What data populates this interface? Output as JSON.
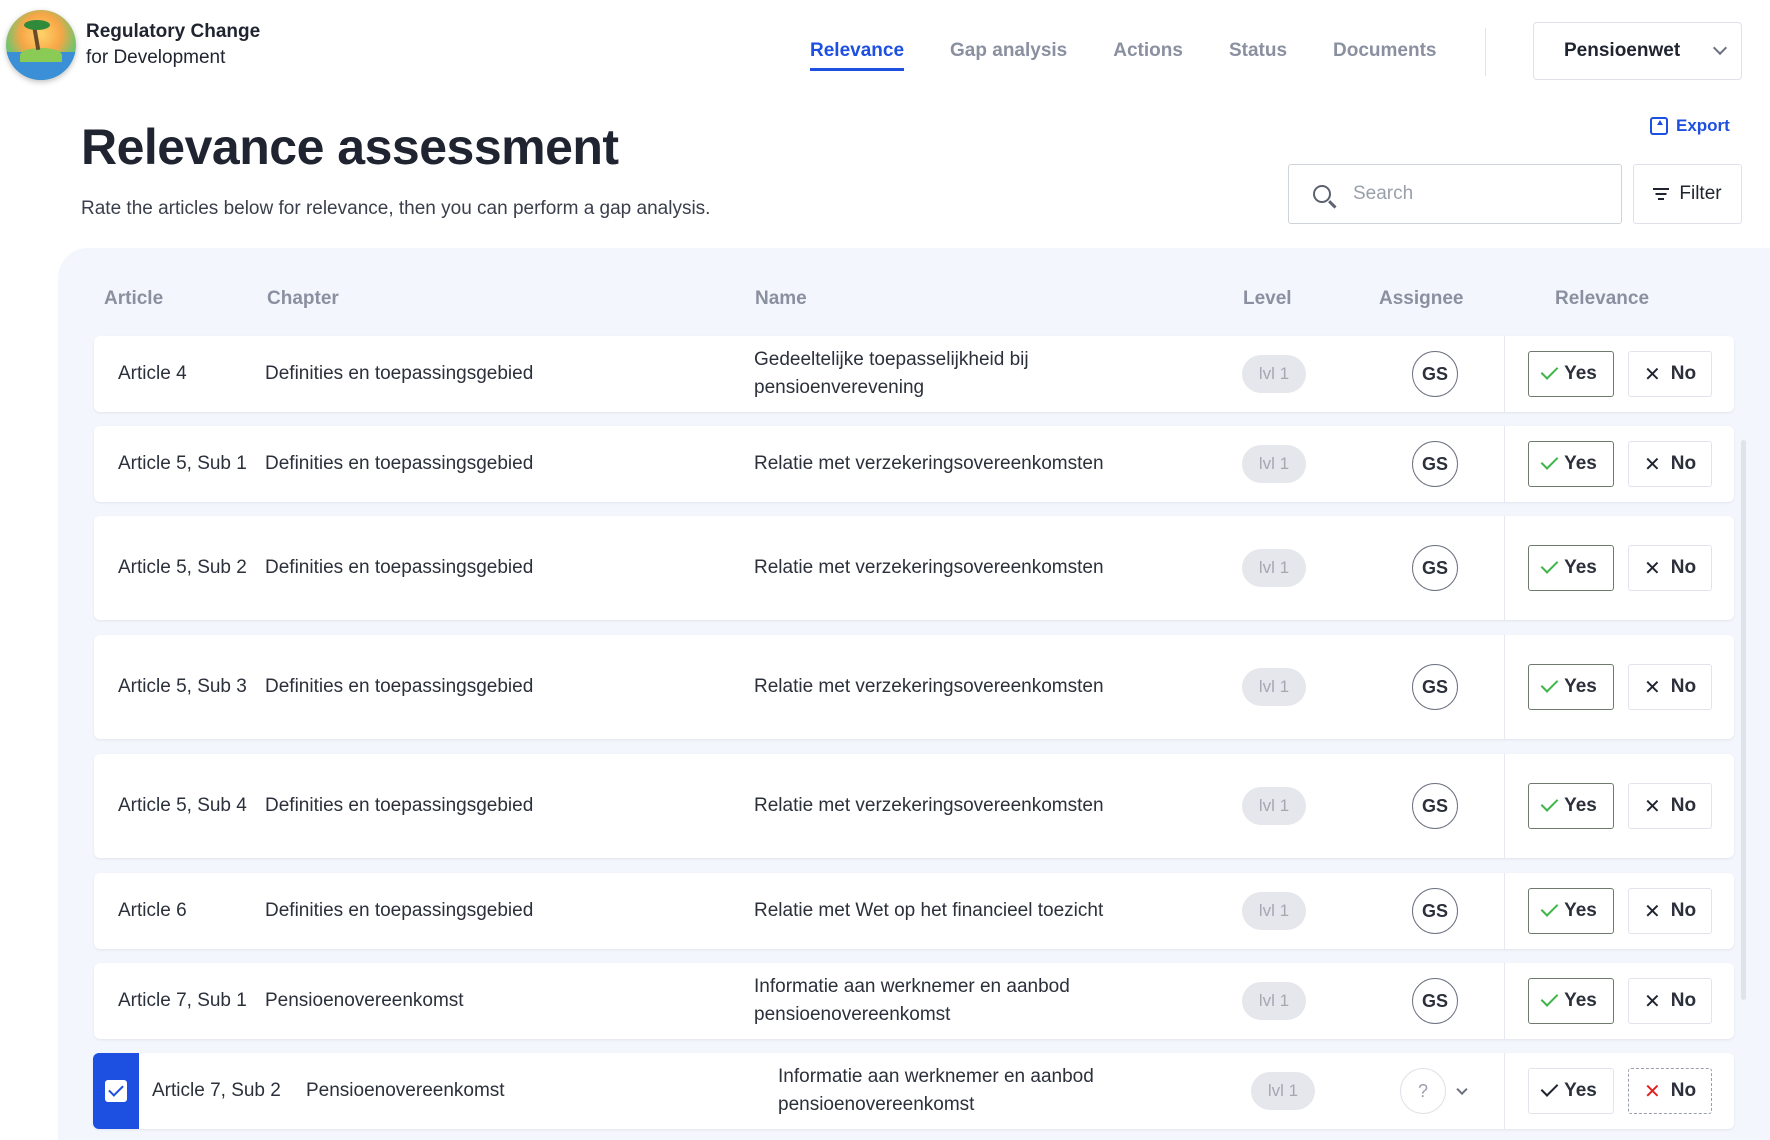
{
  "brand": {
    "title": "Regulatory Change",
    "subtitle": "for Development"
  },
  "nav": {
    "tabs": [
      {
        "label": "Relevance",
        "active": true
      },
      {
        "label": "Gap analysis",
        "active": false
      },
      {
        "label": "Actions",
        "active": false
      },
      {
        "label": "Status",
        "active": false
      },
      {
        "label": "Documents",
        "active": false
      }
    ],
    "law_select": {
      "value": "Pensioenwet"
    }
  },
  "page": {
    "title": "Relevance assessment",
    "subtitle": "Rate the articles below for relevance, then you can perform a gap analysis.",
    "export_label": "Export",
    "search_placeholder": "Search",
    "filter_label": "Filter"
  },
  "table": {
    "columns": [
      "Article",
      "Chapter",
      "Name",
      "Level",
      "Assignee",
      "Relevance"
    ],
    "yes_label": "Yes",
    "no_label": "No",
    "rows": [
      {
        "article": "Article 4",
        "chapter": "Definities en toepassingsgebied",
        "name": "Gedeeltelijke toepasselijkheid bij pensioenverevening",
        "level": "lvl 1",
        "assignee": "GS"
      },
      {
        "article": "Article 5, Sub 1",
        "chapter": "Definities en toepassingsgebied",
        "name": "Relatie met verzekeringsovereenkomsten",
        "level": "lvl 1",
        "assignee": "GS"
      },
      {
        "article": "Article 5, Sub 2",
        "chapter": "Definities en toepassingsgebied",
        "name": "Relatie met verzekeringsovereenkomsten",
        "level": "lvl 1",
        "assignee": "GS"
      },
      {
        "article": "Article 5, Sub 3",
        "chapter": "Definities en toepassingsgebied",
        "name": "Relatie met verzekeringsovereenkomsten",
        "level": "lvl 1",
        "assignee": "GS"
      },
      {
        "article": "Article 5, Sub 4",
        "chapter": "Definities en toepassingsgebied",
        "name": "Relatie met verzekeringsovereenkomsten",
        "level": "lvl 1",
        "assignee": "GS"
      },
      {
        "article": "Article 6",
        "chapter": "Definities en toepassingsgebied",
        "name": "Relatie met Wet op het financieel toezicht",
        "level": "lvl 1",
        "assignee": "GS"
      },
      {
        "article": "Article 7, Sub 1",
        "chapter": "Pensioenovereenkomst",
        "name": "Informatie aan werknemer en aanbod pensioenovereenkomst",
        "level": "lvl 1",
        "assignee": "GS"
      },
      {
        "article": "Article 7, Sub 2",
        "chapter": "Pensioenovereenkomst",
        "name": "Informatie aan werknemer en aanbod pensioenovereenkomst",
        "level": "lvl 1",
        "assignee": "?",
        "selected": true
      }
    ]
  },
  "colors": {
    "accent": "#1d4fe0",
    "yes_check": "#3fb54a",
    "no_x_selected": "#e02020",
    "panel_bg": "#f3f6fc"
  },
  "icons": [
    "logo-icon",
    "chevron-down-icon",
    "export-icon",
    "search-icon",
    "filter-icon",
    "check-icon",
    "x-icon",
    "checkbox-icon"
  ]
}
